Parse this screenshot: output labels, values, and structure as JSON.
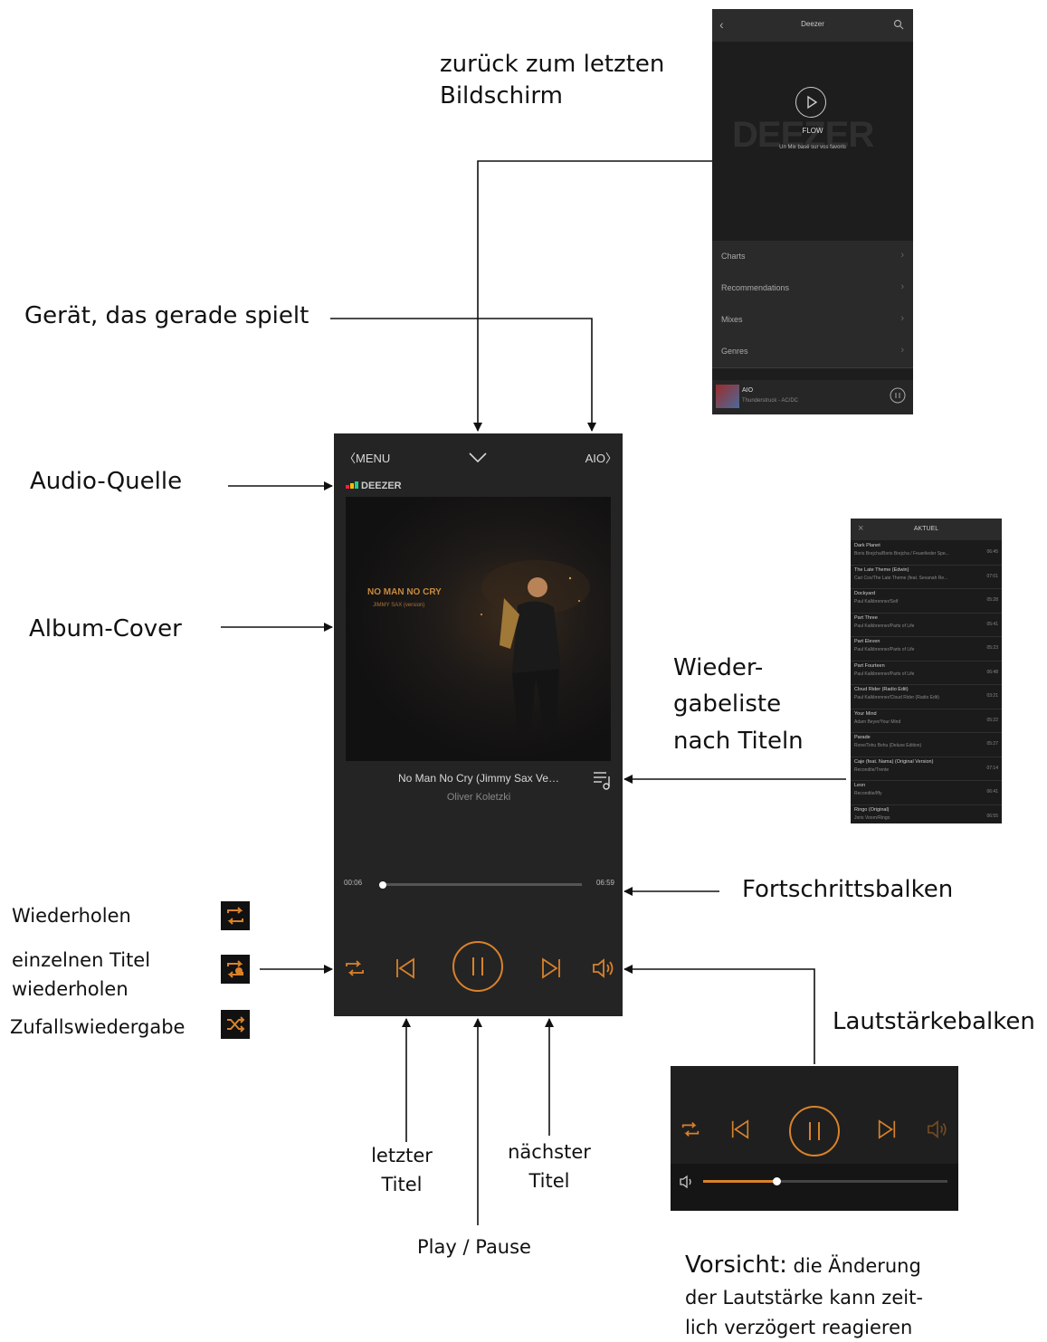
{
  "annotations": {
    "back": [
      "zurück zum letzten",
      "Bildschirm"
    ],
    "device": "Gerät, das gerade spielt",
    "source": "Audio-Quelle",
    "cover": "Album-Cover",
    "playlist": [
      "Wieder-",
      "gabeliste",
      "nach Titeln"
    ],
    "progress": "Fortschrittsbalken",
    "repeat": "Wiederholen",
    "repeat_one": [
      "einzelnen Titel",
      "wiederholen"
    ],
    "shuffle": "Zufallswiedergabe",
    "prev": [
      "letzter",
      "Titel"
    ],
    "next": [
      "nächster",
      "Titel"
    ],
    "playpause": "Play / Pause",
    "volume": "Lautstärkebalken",
    "caution_label": "Vorsicht:",
    "caution_text_1": " die Änderung",
    "caution_text_2": "der Lautstärke kann zeit-",
    "caution_text_3": "lich verzögert reagieren"
  },
  "player": {
    "menu_label": "MENU",
    "device_label": "AIO",
    "source_logo": "DEEZER",
    "cover_title": "NO MAN NO CRY",
    "cover_subtitle": "JIMMY SAX (version)",
    "track_title": "No Man No Cry (Jimmy Sax Ve…",
    "artist": "Oliver Koletzki",
    "time_elapsed": "00:06",
    "time_total": "06:59",
    "progress_fraction": 0.02
  },
  "deezer_screen": {
    "title": "Deezer",
    "flow_label": "FLOW",
    "flow_sub": "Un Mix basé sur vos favoris",
    "logo_watermark": "DEEZER",
    "menu_items": [
      "Charts",
      "Recommendations",
      "Mixes",
      "Genres"
    ],
    "now_playing_device": "AIO",
    "now_playing_track": "Thunderstruck - AC/DC"
  },
  "playlist_screen": {
    "title": "AKTUEL",
    "items": [
      {
        "title": "Dark Planet",
        "sub": "Boris Brejcha/Boris Brejcha / Feuerlieder Spe...",
        "dur": "06:45"
      },
      {
        "title": "The Late Theme (Edwin)",
        "sub": "Cari Cox/The Late Theme (feat. Sevanah Re...",
        "dur": "07:01"
      },
      {
        "title": "Dockyard",
        "sub": "Paul Kalkbrenner/Self",
        "dur": "05:28"
      },
      {
        "title": "Part Three",
        "sub": "Paul Kalkbrenner/Parts of Life",
        "dur": "05:41"
      },
      {
        "title": "Part Eleven",
        "sub": "Paul Kalkbrenner/Parts of Life",
        "dur": "05:23"
      },
      {
        "title": "Part Fourteen",
        "sub": "Paul Kalkbrenner/Parts of Life",
        "dur": "06:48"
      },
      {
        "title": "Cloud Rider (Radio Edit)",
        "sub": "Paul Kalkbrenner/Cloud Rider (Radio Edit)",
        "dur": "03:21"
      },
      {
        "title": "Your Mind",
        "sub": "Adam Beyer/Your Mind",
        "dur": "05:22"
      },
      {
        "title": "Parade",
        "sub": "Rone/Tohu Bohu (Deluxe Edition)",
        "dur": "05:27"
      },
      {
        "title": "Caje (feat. Nama) (Original Version)",
        "sub": "Recondite/Trente",
        "dur": "07:14"
      },
      {
        "title": "Leon",
        "sub": "Recondite/Iffy",
        "dur": "06:41"
      },
      {
        "title": "Ringo (Original)",
        "sub": "Joris Voorn/Ringo",
        "dur": "06:55"
      }
    ]
  },
  "volume_panel": {
    "level_fraction": 0.3
  },
  "colors": {
    "accent": "#d9822b",
    "panel": "#242424"
  }
}
